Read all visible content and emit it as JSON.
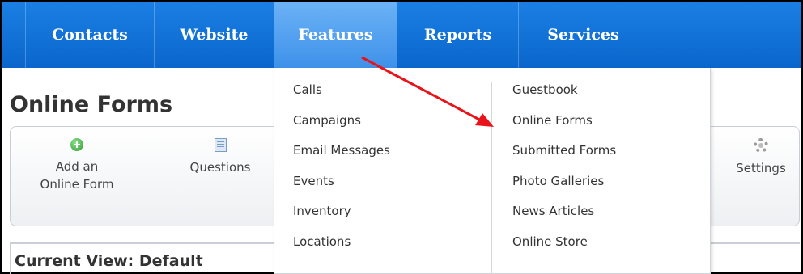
{
  "nav": {
    "items": [
      {
        "label": "Contacts"
      },
      {
        "label": "Website"
      },
      {
        "label": "Features"
      },
      {
        "label": "Reports"
      },
      {
        "label": "Services"
      }
    ]
  },
  "page": {
    "title": "Online Forms",
    "current_view": "Current View: Default"
  },
  "toolbar": {
    "add_form_label": "Add an Online Form",
    "questions_label": "Questions",
    "settings_label": "Settings"
  },
  "features_menu": {
    "left": [
      "Calls",
      "Campaigns",
      "Email Messages",
      "Events",
      "Inventory",
      "Locations"
    ],
    "right": [
      "Guestbook",
      "Online Forms",
      "Submitted Forms",
      "Photo Galleries",
      "News Articles",
      "Online Store"
    ]
  },
  "colors": {
    "nav_bg": "#0a66cc",
    "nav_active": "#4a9cf0",
    "annotation_arrow": "#e8141a"
  },
  "icons": {
    "add_form": "plus-icon",
    "questions": "doc-icon",
    "settings": "gear-icon"
  }
}
